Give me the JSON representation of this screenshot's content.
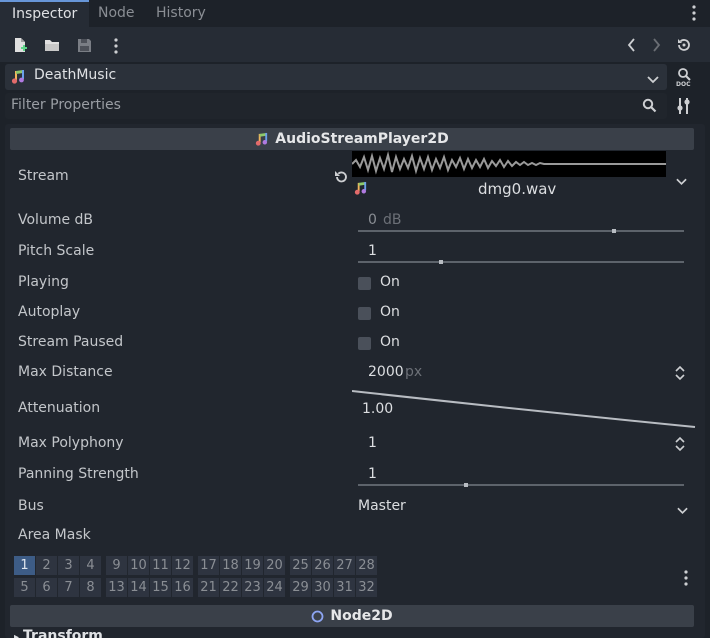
{
  "tabs": [
    {
      "label": "Inspector",
      "active": true
    },
    {
      "label": "Node",
      "active": false
    },
    {
      "label": "History",
      "active": false
    }
  ],
  "object": {
    "name": "DeathMusic",
    "icon": "audio-stream-icon"
  },
  "filter": {
    "placeholder": "Filter Properties"
  },
  "section_audio": {
    "title": "AudioStreamPlayer2D"
  },
  "section_node2d": {
    "title": "Node2D"
  },
  "section_transform": {
    "title": "Transform"
  },
  "properties": {
    "stream": {
      "label": "Stream",
      "file": "dmg0.wav"
    },
    "volume": {
      "label": "Volume dB",
      "value": "0",
      "unit": "dB",
      "level": 0.79
    },
    "pitch": {
      "label": "Pitch Scale",
      "value": "1",
      "level": 0.25
    },
    "playing": {
      "label": "Playing",
      "check_label": "On",
      "checked": false
    },
    "autoplay": {
      "label": "Autoplay",
      "check_label": "On",
      "checked": false
    },
    "stream_paused": {
      "label": "Stream Paused",
      "check_label": "On",
      "checked": false
    },
    "max_distance": {
      "label": "Max Distance",
      "value": "2000",
      "unit": "px"
    },
    "attenuation": {
      "label": "Attenuation",
      "value": "1.00"
    },
    "max_polyphony": {
      "label": "Max Polyphony",
      "value": "1"
    },
    "panning": {
      "label": "Panning Strength",
      "value": "1",
      "level": 0.33
    },
    "bus": {
      "label": "Bus",
      "value": "Master"
    },
    "area_mask": {
      "label": "Area Mask"
    }
  },
  "area_mask_rows": [
    [
      "1",
      "2",
      "3",
      "4",
      "9",
      "10",
      "11",
      "12",
      "17",
      "18",
      "19",
      "20",
      "25",
      "26",
      "27",
      "28"
    ],
    [
      "5",
      "6",
      "7",
      "8",
      "13",
      "14",
      "15",
      "16",
      "21",
      "22",
      "23",
      "24",
      "29",
      "30",
      "31",
      "32"
    ]
  ],
  "area_mask_on": [
    "1"
  ],
  "colors": {
    "accent": "#6796d8",
    "panel": "#21262e",
    "header": "#3a4049"
  }
}
